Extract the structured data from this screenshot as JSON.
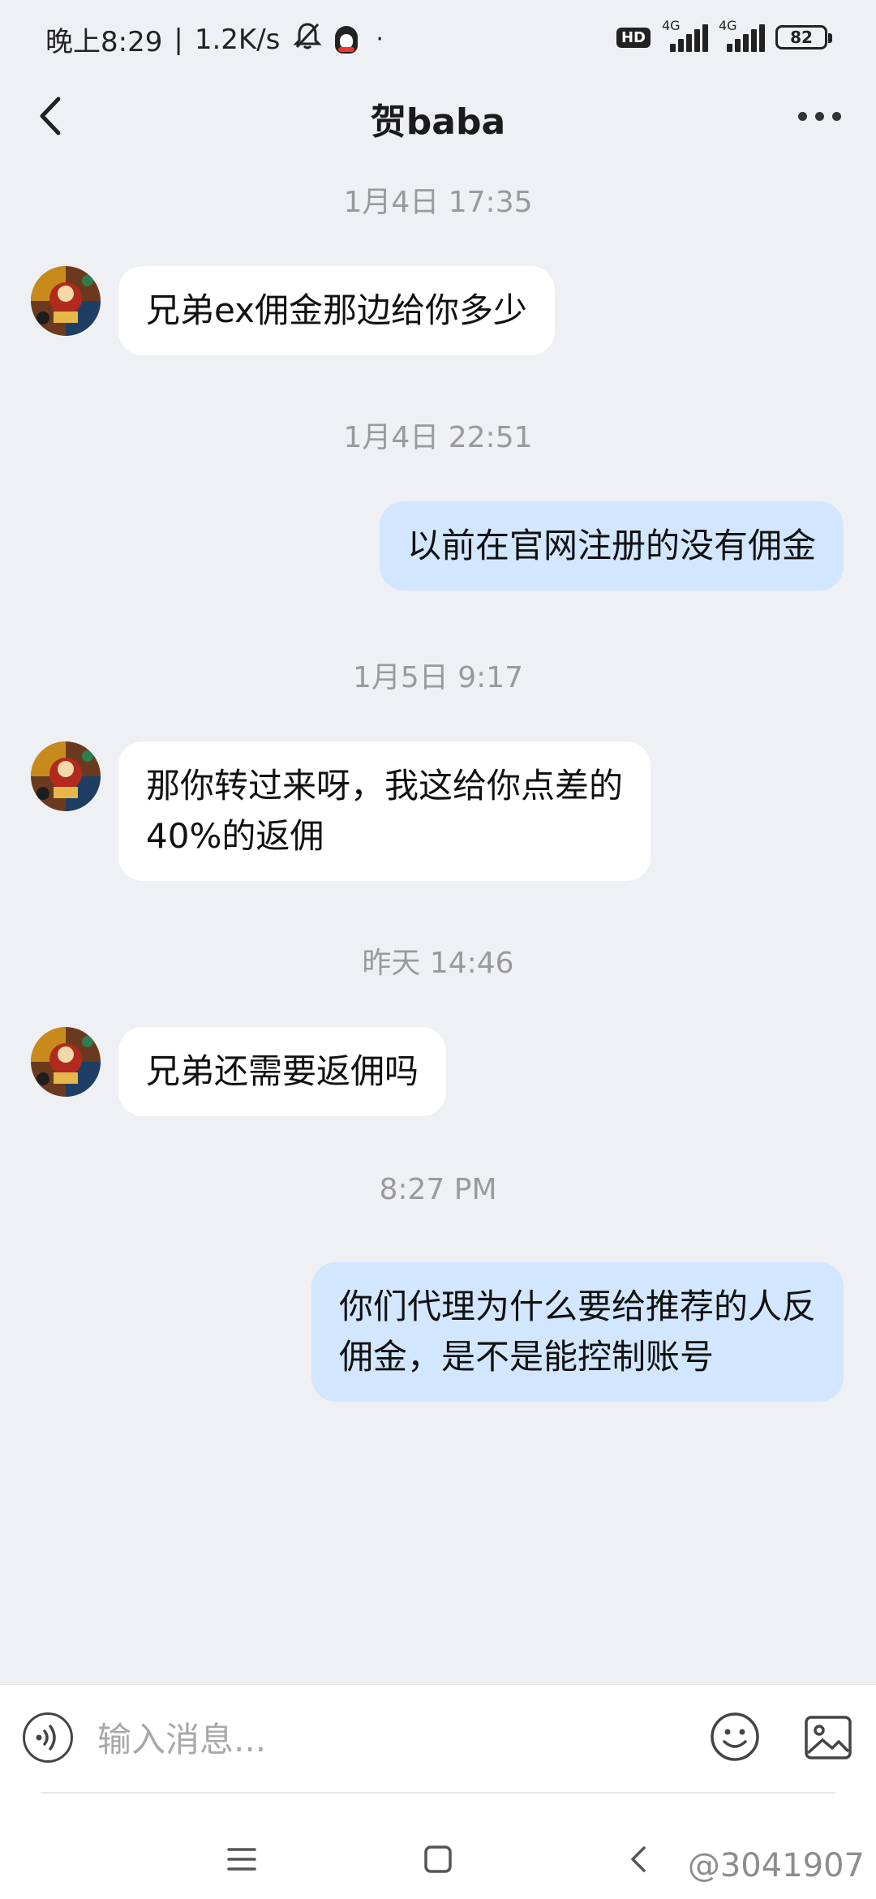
{
  "status_bar": {
    "time": "晚上8:29",
    "speed": "1.2K/s",
    "hd": "HD",
    "network_1": "4G",
    "network_2": "4G",
    "battery": "82",
    "icons": [
      "mute-bell-icon",
      "qq-icon",
      "dot-icon",
      "signal-icon",
      "battery-icon"
    ]
  },
  "header": {
    "title": "贺baba",
    "back_icon": "chevron-left-icon",
    "more_icon": "more-dots-icon"
  },
  "messages": [
    {
      "type": "time",
      "text": "1月4日 17:35"
    },
    {
      "type": "incoming",
      "lines": [
        "兄弟ex佣金那边给你多少"
      ]
    },
    {
      "type": "time",
      "text": "1月4日 22:51"
    },
    {
      "type": "outgoing",
      "lines": [
        "以前在官网注册的没有佣金"
      ]
    },
    {
      "type": "time",
      "text": "1月5日 9:17"
    },
    {
      "type": "incoming",
      "lines": [
        "那你转过来呀，我这给你点差的",
        "40%的返佣"
      ]
    },
    {
      "type": "time",
      "text": "昨天 14:46"
    },
    {
      "type": "incoming",
      "lines": [
        "兄弟还需要返佣吗"
      ]
    },
    {
      "type": "time",
      "text": "8:27 PM"
    },
    {
      "type": "outgoing",
      "lines": [
        "你们代理为什么要给推荐的人反",
        "佣金，是不是能控制账号"
      ]
    }
  ],
  "input_bar": {
    "placeholder": "输入消息...",
    "icons": [
      "voice-icon",
      "emoji-icon",
      "image-icon"
    ]
  },
  "nav_bar": {
    "icons": [
      "menu-icon",
      "home-icon",
      "back-icon"
    ],
    "watermark": "@3041907"
  },
  "colors": {
    "background": "#eff0f3",
    "incoming_bubble": "#ffffff",
    "outgoing_bubble": "#d2e6fd",
    "timestamp": "#9a9a9a"
  }
}
